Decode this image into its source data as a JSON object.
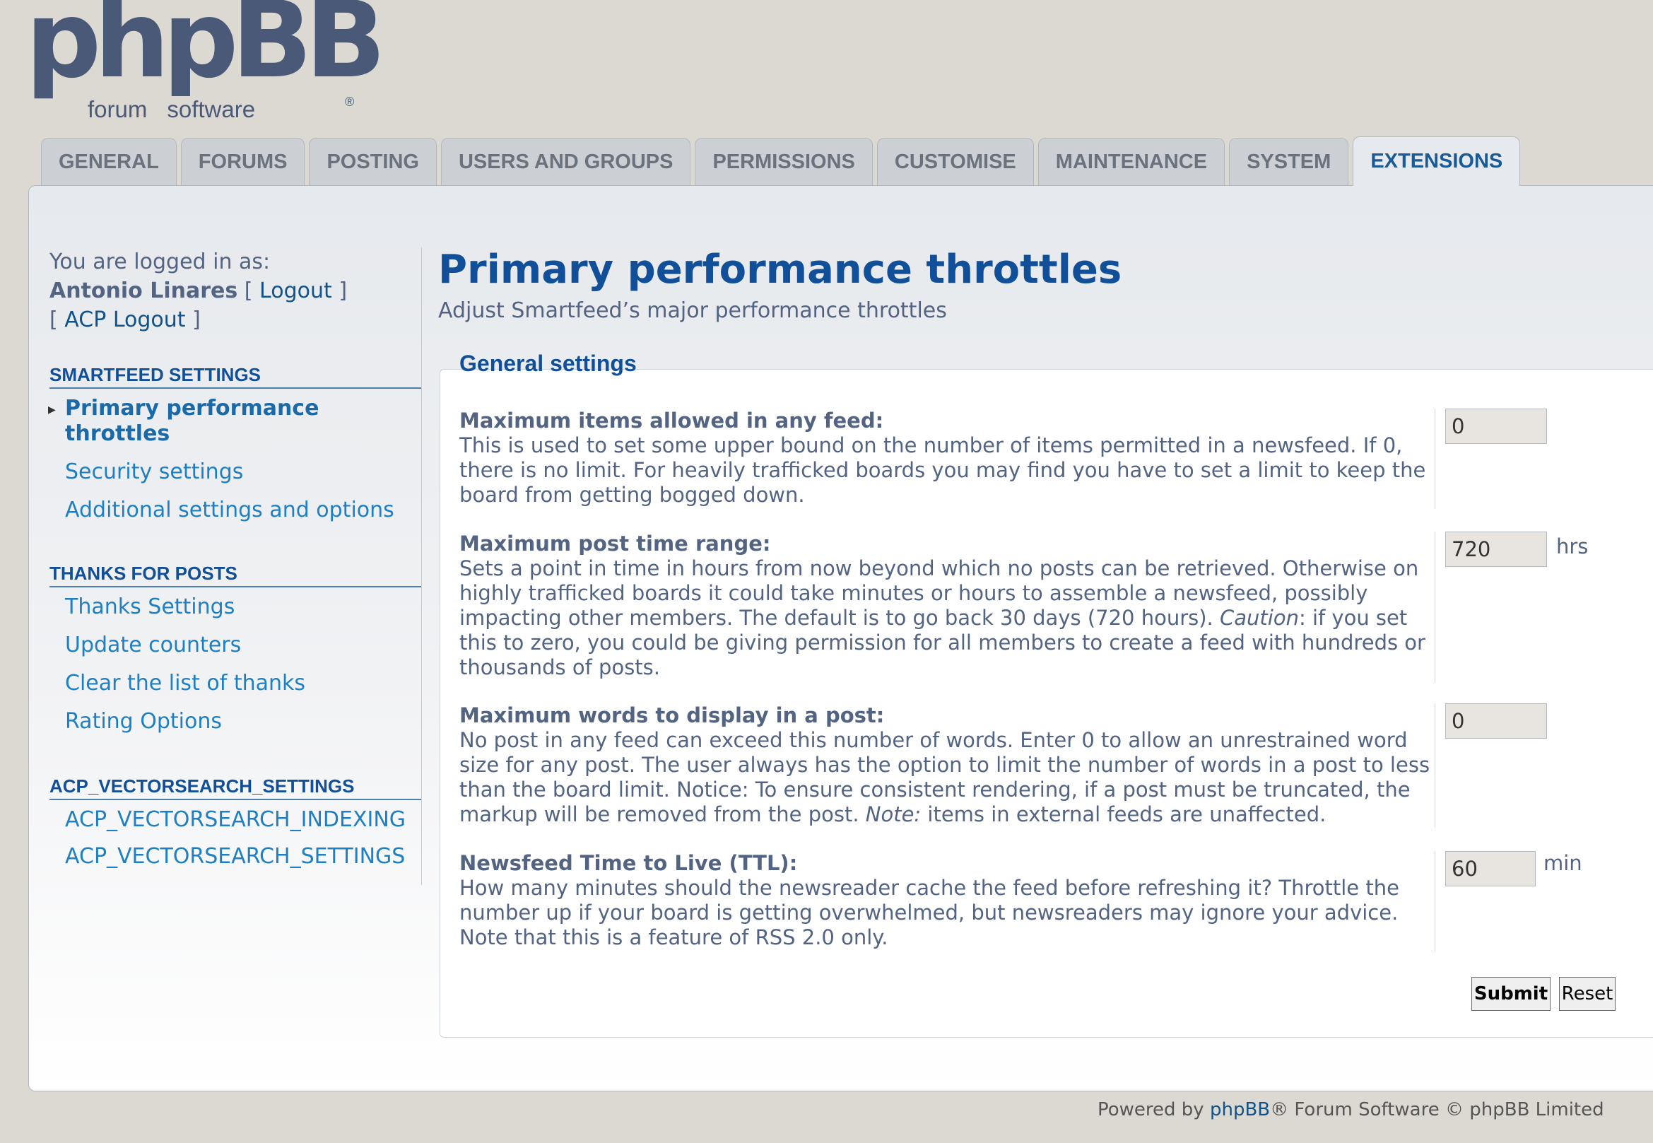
{
  "logo": {
    "word": "phpBB",
    "sub_a": "forum",
    "sub_b": "software",
    "reg": "®"
  },
  "tabs": [
    {
      "label": "GENERAL"
    },
    {
      "label": "FORUMS"
    },
    {
      "label": "POSTING"
    },
    {
      "label": "USERS AND GROUPS"
    },
    {
      "label": "PERMISSIONS"
    },
    {
      "label": "CUSTOMISE"
    },
    {
      "label": "MAINTENANCE"
    },
    {
      "label": "SYSTEM"
    },
    {
      "label": "EXTENSIONS"
    }
  ],
  "login": {
    "prefix": "You are logged in as:",
    "username": "Antonio Linares",
    "logout": "Logout",
    "acp_logout": "ACP Logout",
    "bracket_open": "[",
    "bracket_close": "]"
  },
  "sidebar": {
    "sections": [
      {
        "title": "SMARTFEED SETTINGS",
        "items": [
          {
            "label": "Primary performance throttles"
          },
          {
            "label": "Security settings"
          },
          {
            "label": "Additional settings and options"
          }
        ]
      },
      {
        "title": "THANKS FOR POSTS",
        "items": [
          {
            "label": "Thanks Settings"
          },
          {
            "label": "Update counters"
          },
          {
            "label": "Clear the list of thanks"
          },
          {
            "label": "Rating Options"
          }
        ]
      },
      {
        "title": "ACP_VECTORSEARCH_SETTINGS",
        "items": [
          {
            "label": "ACP_VECTORSEARCH_INDEXING"
          },
          {
            "label": "ACP_VECTORSEARCH_SETTINGS"
          }
        ]
      }
    ]
  },
  "page": {
    "title": "Primary performance throttles",
    "subtitle": "Adjust Smartfeed’s major performance throttles",
    "legend": "General settings"
  },
  "settings": [
    {
      "label": "Maximum items allowed in any feed:",
      "desc": "This is used to set some upper bound on the number of items permitted in a newsfeed. If 0, there is no limit. For heavily trafficked boards you may find you have to set a limit to keep the board from getting bogged down.",
      "value": "0",
      "unit": ""
    },
    {
      "label": "Maximum post time range:",
      "desc_a": "Sets a point in time in hours from now beyond which no posts can be retrieved. Otherwise on highly trafficked boards it could take minutes or hours to assemble a newsfeed, possibly impacting other members. The default is to go back 30 days (720 hours). ",
      "desc_em": "Caution",
      "desc_b": ": if you set this to zero, you could be giving permission for all members to create a feed with hundreds or thousands of posts.",
      "value": "720",
      "unit": "hrs"
    },
    {
      "label": "Maximum words to display in a post:",
      "desc_a": "No post in any feed can exceed this number of words. Enter 0 to allow an unrestrained word size for any post. The user always has the option to limit the number of words in a post to less than the board limit. Notice: To ensure consistent rendering, if a post must be truncated, the markup will be removed from the post. ",
      "desc_em": "Note:",
      "desc_b": " items in external feeds are unaffected.",
      "value": "0",
      "unit": ""
    },
    {
      "label": "Newsfeed Time to Live (TTL):",
      "desc": "How many minutes should the newsreader cache the feed before refreshing it? Throttle the number up if your board is getting overwhelmed, but newsreaders may ignore your advice. Note that this is a feature of RSS 2.0 only.",
      "value": "60",
      "unit": "min"
    }
  ],
  "buttons": {
    "submit": "Submit",
    "reset": "Reset"
  },
  "footer": {
    "prefix": "Powered by ",
    "link": "phpBB",
    "suffix": "® Forum Software © phpBB Limited"
  },
  "colors": {
    "accent": "#115098",
    "link": "#1e80c2",
    "background": "#dcd9d2"
  }
}
